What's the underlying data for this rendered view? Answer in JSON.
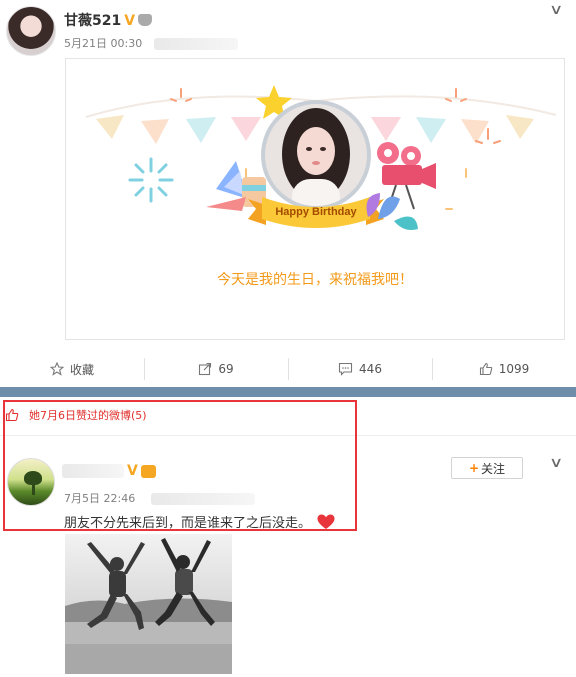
{
  "post1": {
    "username": "甘薇521",
    "verified_mark": "V",
    "timestamp": "5月21日 00:30",
    "card": {
      "banner_text": "Happy Birthday",
      "greeting": "今天是我的生日，来祝福我吧！"
    },
    "actions": [
      {
        "icon": "star-icon",
        "label": "收藏"
      },
      {
        "icon": "share-icon",
        "label": "69"
      },
      {
        "icon": "comment-icon",
        "label": "446"
      },
      {
        "icon": "like-icon",
        "label": "1099"
      }
    ]
  },
  "liked_section": {
    "label": "她7月6日赞过的微博(5)"
  },
  "post2": {
    "verified_mark": "V",
    "timestamp": "7月5日 22:46",
    "follow_label": "关注",
    "content": "朋友不分先来后到，而是谁来了之后没走。"
  },
  "colors": {
    "accent_orange": "#ff8200",
    "highlight_red": "#e8353b",
    "divider_blue": "#6f8eaa",
    "greeting_orange": "#f39a1a"
  }
}
